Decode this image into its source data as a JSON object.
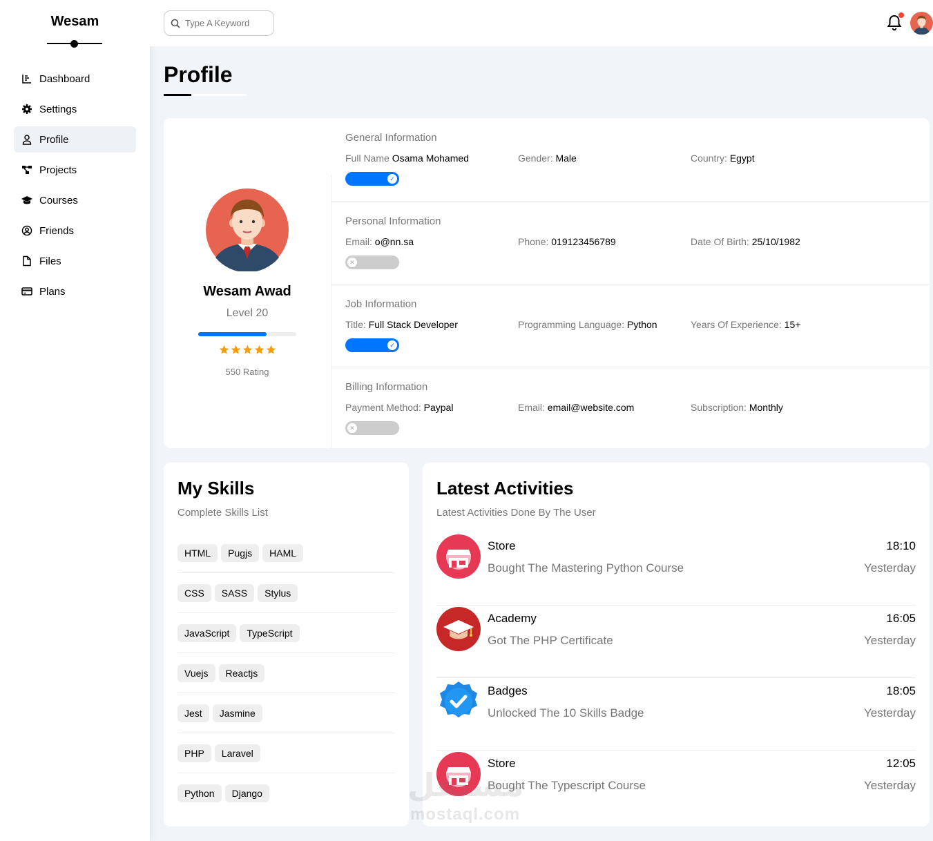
{
  "brand": "Wesam",
  "nav": [
    {
      "label": "Dashboard",
      "icon": "chart-icon"
    },
    {
      "label": "Settings",
      "icon": "gear-icon"
    },
    {
      "label": "Profile",
      "icon": "user-icon",
      "active": true
    },
    {
      "label": "Projects",
      "icon": "diagram-icon"
    },
    {
      "label": "Courses",
      "icon": "graduation-cap-icon"
    },
    {
      "label": "Friends",
      "icon": "user-circle-icon"
    },
    {
      "label": "Files",
      "icon": "file-icon"
    },
    {
      "label": "Plans",
      "icon": "credit-card-icon"
    }
  ],
  "header": {
    "search_placeholder": "Type A Keyword",
    "notifications_dot": true
  },
  "page_title": "Profile",
  "profile": {
    "name": "Wesam Awad",
    "level": "Level 20",
    "level_progress": 0.7,
    "stars": 5,
    "rating": "550 Rating"
  },
  "info_sections": [
    {
      "title": "General Information",
      "items": [
        {
          "label": "Full Name",
          "value": "Osama Mohamed"
        },
        {
          "label": "Gender:",
          "value": "Male"
        },
        {
          "label": "Country:",
          "value": "Egypt"
        }
      ],
      "toggle_on": true
    },
    {
      "title": "Personal Information",
      "items": [
        {
          "label": "Email:",
          "value": "o@nn.sa"
        },
        {
          "label": "Phone:",
          "value": "019123456789"
        },
        {
          "label": "Date Of Birth:",
          "value": "25/10/1982"
        }
      ],
      "toggle_on": false
    },
    {
      "title": "Job Information",
      "items": [
        {
          "label": "Title:",
          "value": "Full Stack Developer"
        },
        {
          "label": "Programming Language:",
          "value": "Python"
        },
        {
          "label": "Years Of Experience:",
          "value": "15+"
        }
      ],
      "toggle_on": true
    },
    {
      "title": "Billing Information",
      "items": [
        {
          "label": "Payment Method:",
          "value": "Paypal"
        },
        {
          "label": "Email:",
          "value": "email@website.com"
        },
        {
          "label": "Subscription:",
          "value": "Monthly"
        }
      ],
      "toggle_on": false
    }
  ],
  "skills": {
    "title": "My Skills",
    "subtitle": "Complete Skills List",
    "rows": [
      [
        "HTML",
        "Pugjs",
        "HAML"
      ],
      [
        "CSS",
        "SASS",
        "Stylus"
      ],
      [
        "JavaScript",
        "TypeScript"
      ],
      [
        "Vuejs",
        "Reactjs"
      ],
      [
        "Jest",
        "Jasmine"
      ],
      [
        "PHP",
        "Laravel"
      ],
      [
        "Python",
        "Django"
      ]
    ]
  },
  "activities": {
    "title": "Latest Activities",
    "subtitle": "Latest Activities Done By The User",
    "items": [
      {
        "name": "Store",
        "desc": "Bought The Mastering Python Course",
        "time": "18:10",
        "day": "Yesterday",
        "icon": "store-icon"
      },
      {
        "name": "Academy",
        "desc": "Got The PHP Certificate",
        "time": "16:05",
        "day": "Yesterday",
        "icon": "graduation-cap-icon"
      },
      {
        "name": "Badges",
        "desc": "Unlocked The 10 Skills Badge",
        "time": "18:05",
        "day": "Yesterday",
        "icon": "verified-badge-icon"
      },
      {
        "name": "Store",
        "desc": "Bought The Typescript Course",
        "time": "12:05",
        "day": "Yesterday",
        "icon": "store-icon"
      }
    ]
  },
  "watermark": {
    "arabic": "مستقل",
    "latin": "mostaql.com"
  },
  "colors": {
    "accent": "#0075ff",
    "star": "#f59e0b",
    "store": "#e63956",
    "academy": "#c62828",
    "badge": "#1e88e5"
  }
}
